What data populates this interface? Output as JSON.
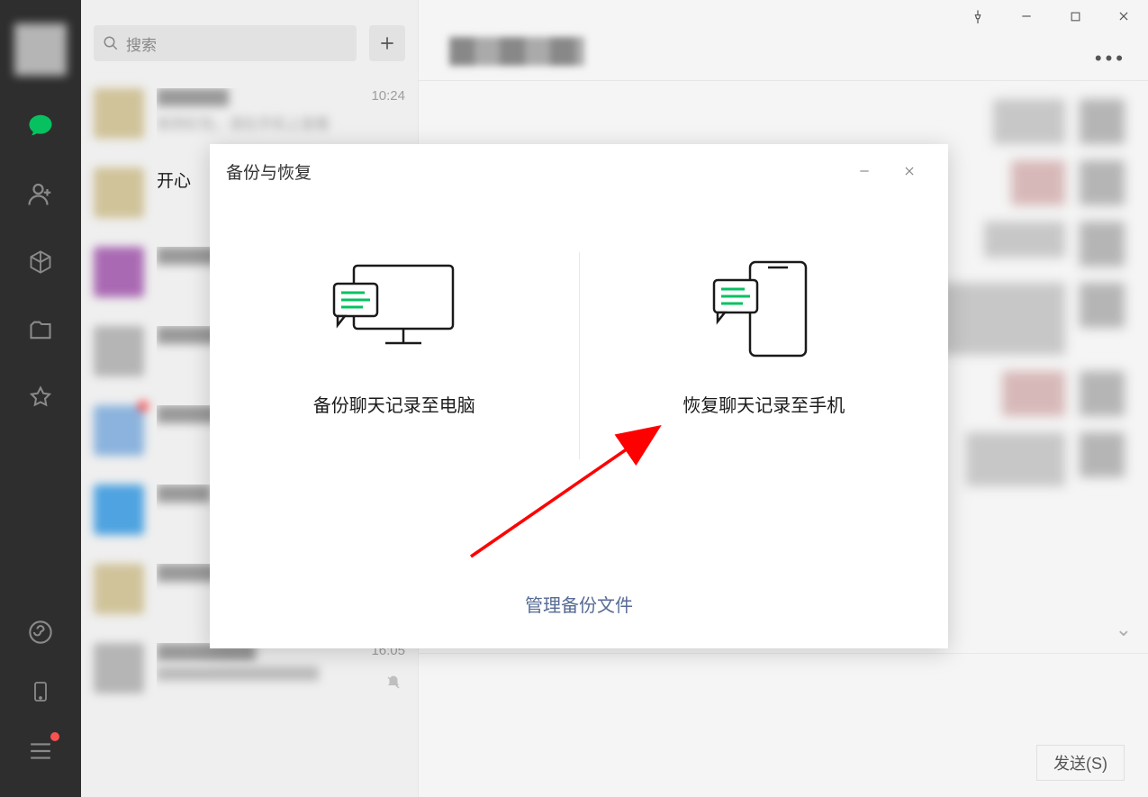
{
  "search": {
    "placeholder": "搜索"
  },
  "chats": [
    {
      "title": "",
      "time": "10:24",
      "preview": "收到红包，请在手机上查看"
    },
    {
      "title": "开心",
      "time": "",
      "preview": ""
    },
    {
      "title": "",
      "time": "",
      "preview": ""
    },
    {
      "title": "",
      "time": "",
      "preview": ""
    },
    {
      "title": "",
      "time": "",
      "preview": ""
    },
    {
      "title": "",
      "time": "",
      "preview": ""
    },
    {
      "title": "",
      "time": "",
      "preview": ""
    },
    {
      "title": "",
      "time": "16:05",
      "preview": ""
    }
  ],
  "modal": {
    "title": "备份与恢复",
    "backup_label": "备份聊天记录至电脑",
    "restore_label": "恢复聊天记录至手机",
    "manage_label": "管理备份文件"
  },
  "send_button": "发送(S)"
}
